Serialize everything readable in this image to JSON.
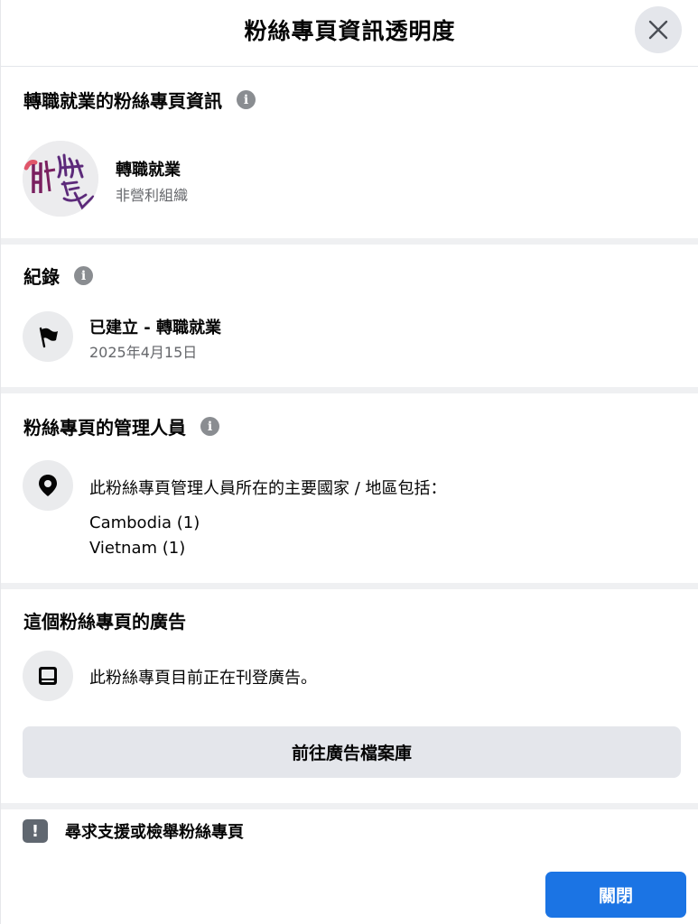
{
  "header": {
    "title": "粉絲專頁資訊透明度"
  },
  "page_info": {
    "title": "轉職就業的粉絲專頁資訊",
    "page_name": "轉職就業",
    "category": "非營利組織"
  },
  "history": {
    "title": "紀錄",
    "event": "已建立 - 轉職就業",
    "date": "2025年4月15日"
  },
  "admins": {
    "title": "粉絲專頁的管理人員",
    "description": "此粉絲專頁管理人員所在的主要國家 / 地區包括：",
    "countries": [
      "Cambodia (1)",
      "Vietnam (1)"
    ]
  },
  "ads": {
    "title": "這個粉絲專頁的廣告",
    "status": "此粉絲專頁目前正在刊登廣告。",
    "archive_button": "前往廣告檔案庫"
  },
  "support": {
    "label": "尋求支援或檢舉粉絲專頁"
  },
  "footer": {
    "close_button": "關閉"
  },
  "colors": {
    "primary_button": "#1b74e4",
    "secondary_button": "#e4e6eb",
    "icon_bg": "#eaebed",
    "muted_text": "#65676b"
  }
}
